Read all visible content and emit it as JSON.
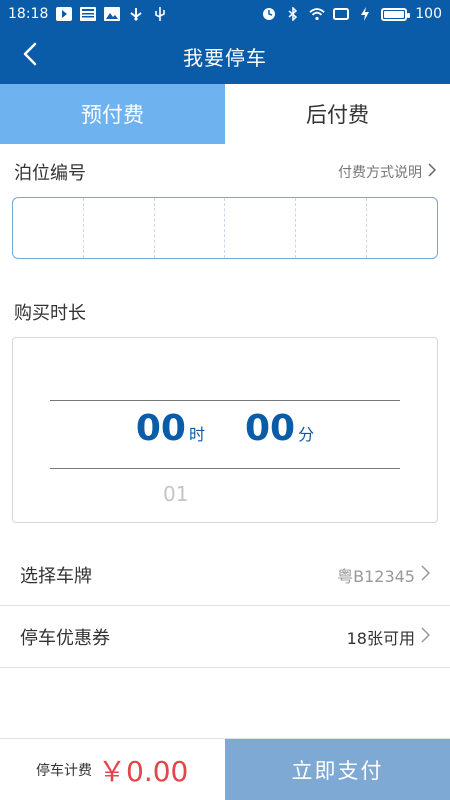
{
  "status_bar": {
    "time": "18:18",
    "left_icons": [
      "play-icon",
      "news-icon",
      "image-icon",
      "usb-icon",
      "usb-plug-icon"
    ],
    "right_icons": [
      "alarm-icon",
      "bluetooth-icon",
      "wifi-icon",
      "screen-icon",
      "charging-icon",
      "battery-icon"
    ],
    "battery_level": "100"
  },
  "nav": {
    "title": "我要停车"
  },
  "tabs": [
    {
      "label": "预付费",
      "active": true
    },
    {
      "label": "后付费",
      "active": false
    }
  ],
  "berth": {
    "title": "泊位编号",
    "help_label": "付费方式说明",
    "cells": [
      "",
      "",
      "",
      "",
      "",
      ""
    ]
  },
  "duration": {
    "title": "购买时长",
    "hours": "00",
    "hours_unit": "时",
    "minutes": "00",
    "minutes_unit": "分",
    "next_hour": "01"
  },
  "plate": {
    "label": "选择车牌",
    "value": "粤B12345"
  },
  "coupon": {
    "label": "停车优惠券",
    "value": "18张可用"
  },
  "bottom": {
    "fee_label": "停车计费",
    "fee_value": "￥0.00",
    "pay_label": "立即支付"
  },
  "colors": {
    "primary": "#0a5ba8",
    "tab_active": "#6fb2f0",
    "fee": "#e2454a",
    "pay_button": "#7ea9d4"
  }
}
